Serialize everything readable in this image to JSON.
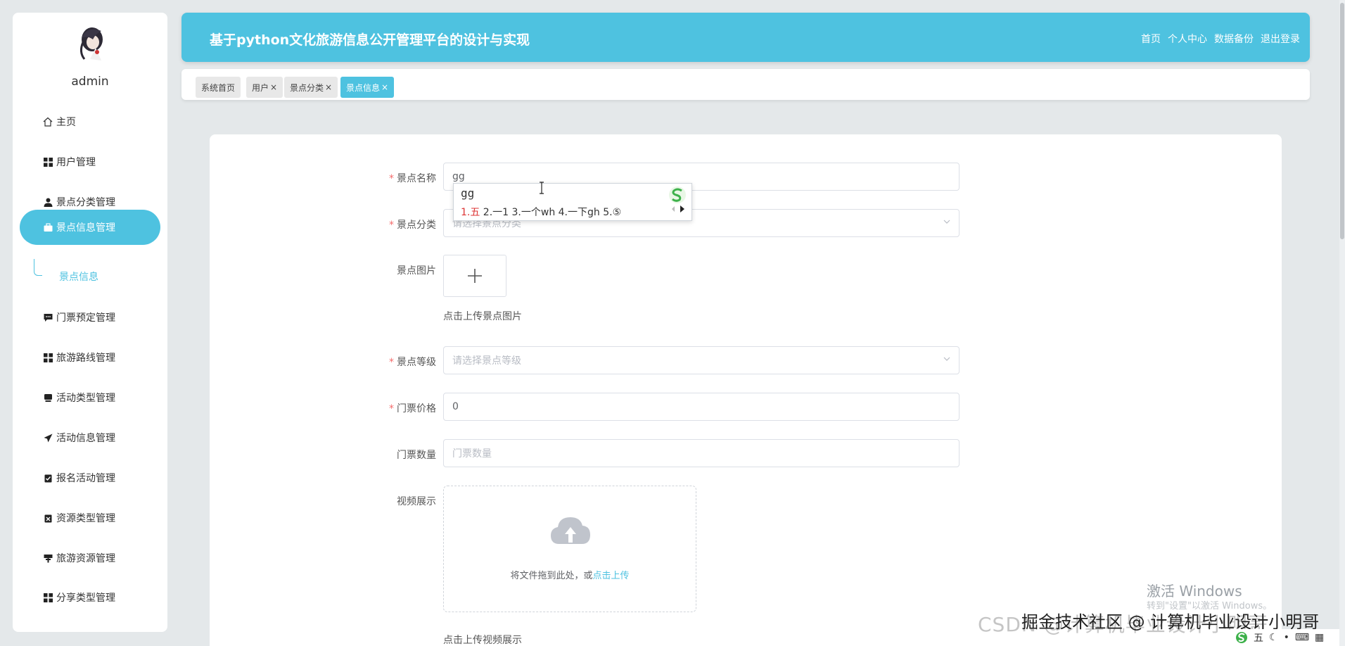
{
  "sidebar": {
    "username": "admin",
    "items": [
      {
        "label": "主页",
        "icon": "home-icon"
      },
      {
        "label": "用户管理",
        "icon": "grid-icon"
      },
      {
        "label": "景点分类管理",
        "icon": "user-icon"
      },
      {
        "label": "景点信息管理",
        "icon": "briefcase-icon"
      },
      {
        "label": "门票预定管理",
        "icon": "chat-icon"
      },
      {
        "label": "旅游路线管理",
        "icon": "grid-icon"
      },
      {
        "label": "活动类型管理",
        "icon": "box-icon"
      },
      {
        "label": "活动信息管理",
        "icon": "send-icon"
      },
      {
        "label": "报名活动管理",
        "icon": "clipboard-check-icon"
      },
      {
        "label": "资源类型管理",
        "icon": "clipboard-x-icon"
      },
      {
        "label": "旅游资源管理",
        "icon": "sign-icon"
      },
      {
        "label": "分享类型管理",
        "icon": "grid-icon"
      }
    ],
    "sub_item": "景点信息"
  },
  "header": {
    "title": "基于python文化旅游信息公开管理平台的设计与实现",
    "links": [
      "首页",
      "个人中心",
      "数据备份",
      "退出登录"
    ]
  },
  "tabs": [
    {
      "label": "系统首页",
      "closable": false
    },
    {
      "label": "用户",
      "closable": true
    },
    {
      "label": "景点分类",
      "closable": true
    },
    {
      "label": "景点信息",
      "closable": true
    }
  ],
  "tab_close_symbol": "×",
  "form": {
    "name_label": "景点名称",
    "name_value": "gg",
    "category_label": "景点分类",
    "category_placeholder": "请选择景点分类",
    "image_label": "景点图片",
    "image_hint": "点击上传景点图片",
    "level_label": "景点等级",
    "level_placeholder": "请选择景点等级",
    "price_label": "门票价格",
    "price_value": "0",
    "quantity_label": "门票数量",
    "quantity_placeholder": "门票数量",
    "video_label": "视频展示",
    "video_drop_text": "将文件拖到此处，或",
    "video_drop_link": "点击上传",
    "video_hint": "点击上传视频展示",
    "required_mark": "*"
  },
  "ime": {
    "composition": "gg",
    "cand1": "1.五",
    "cand_rest": " 2.一1  3.一个wh  4.一下gh  5.⑤"
  },
  "watermarks": {
    "win_title": "激活 Windows",
    "win_sub": "转到\"设置\"以激活 Windows。",
    "csdn": "CSDN @计算机毕业设计小明哥",
    "juejin": "掘金技术社区 @ 计算机毕业设计小明哥"
  },
  "tray": {
    "ime_mode": "五"
  },
  "colors": {
    "accent": "#4ec2e0",
    "required": "#f56c6c"
  }
}
